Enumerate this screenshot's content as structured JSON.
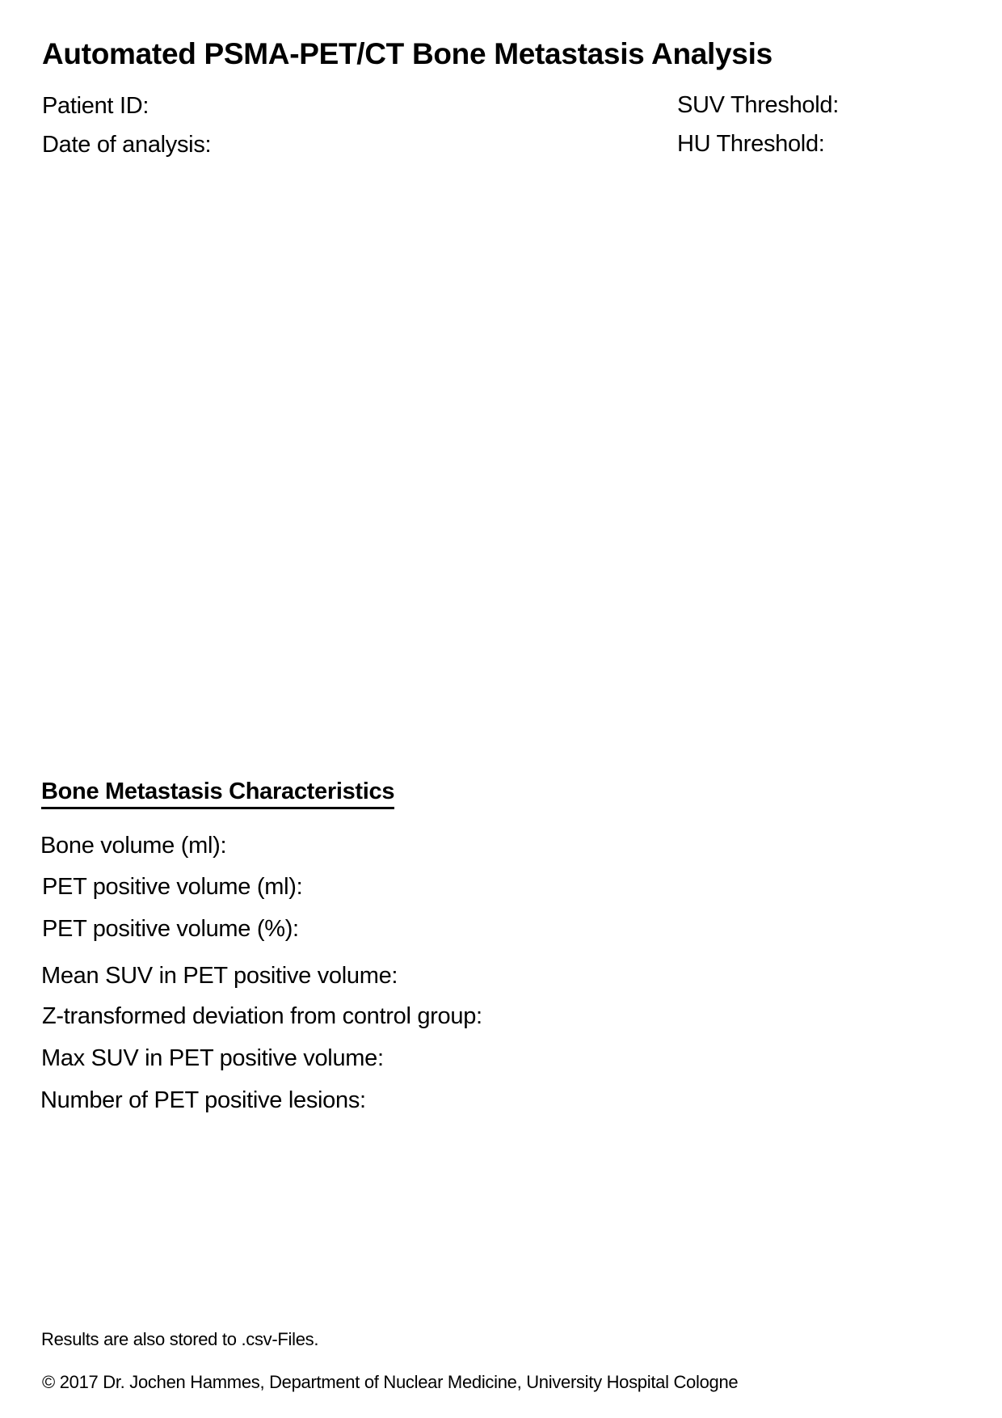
{
  "title": "Automated PSMA-PET/CT Bone Metastasis Analysis",
  "header": {
    "patient_id_label": "Patient ID:",
    "date_label": "Date of analysis:",
    "suv_threshold_label": "SUV Threshold:",
    "hu_threshold_label": "HU Threshold:"
  },
  "characteristics": {
    "heading": "Bone Metastasis Characteristics",
    "items": [
      "Bone volume (ml):",
      "PET positive volume (ml):",
      "PET positive volume (%):",
      "Mean SUV in PET positive volume:",
      "Z-transformed deviation from control group:",
      "Max SUV in PET positive volume:",
      "Number of PET positive lesions:"
    ]
  },
  "footer": {
    "note": "Results are also stored to .csv-Files.",
    "copyright": "© 2017 Dr. Jochen Hammes, Department of Nuclear Medicine, University Hospital Cologne"
  }
}
